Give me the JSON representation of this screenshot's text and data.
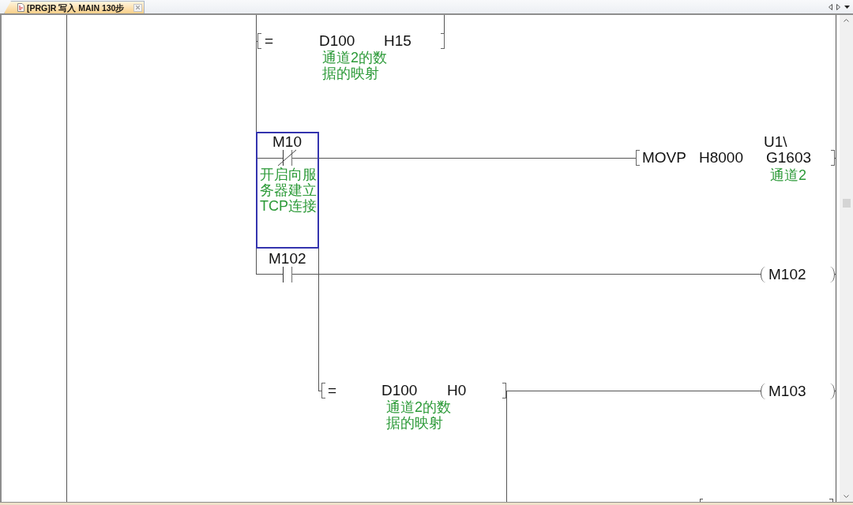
{
  "tabs": [
    {
      "title": "[PRG]R 写入 MAIN 130步",
      "selected": true
    }
  ],
  "ladder": {
    "elements": [
      {
        "kind": "instruction",
        "operator": "=",
        "operands": [
          {
            "text": "D100",
            "comment": [
              "通道2的数",
              "据的映射"
            ]
          },
          {
            "text": "H15"
          }
        ],
        "selected": false
      },
      {
        "kind": "contact",
        "device": "M10",
        "normally_closed": true,
        "comment": [
          "开启向服",
          "务器建立",
          "TCP连接"
        ],
        "selected": true
      },
      {
        "kind": "instruction",
        "operator": "MOVP",
        "operands": [
          {
            "text": "H8000"
          },
          {
            "prefix": "U1\\",
            "text": "G1603",
            "comment": [
              "通道2"
            ]
          }
        ],
        "selected": false
      },
      {
        "kind": "contact",
        "device": "M102",
        "normally_closed": false,
        "selected": false
      },
      {
        "kind": "coil",
        "device": "M102",
        "selected": false
      },
      {
        "kind": "instruction",
        "operator": "=",
        "operands": [
          {
            "text": "D100",
            "comment": [
              "通道2的数",
              "据的映射"
            ]
          },
          {
            "text": "H0"
          }
        ],
        "selected": false
      },
      {
        "kind": "coil",
        "device": "M103",
        "selected": false
      }
    ]
  }
}
